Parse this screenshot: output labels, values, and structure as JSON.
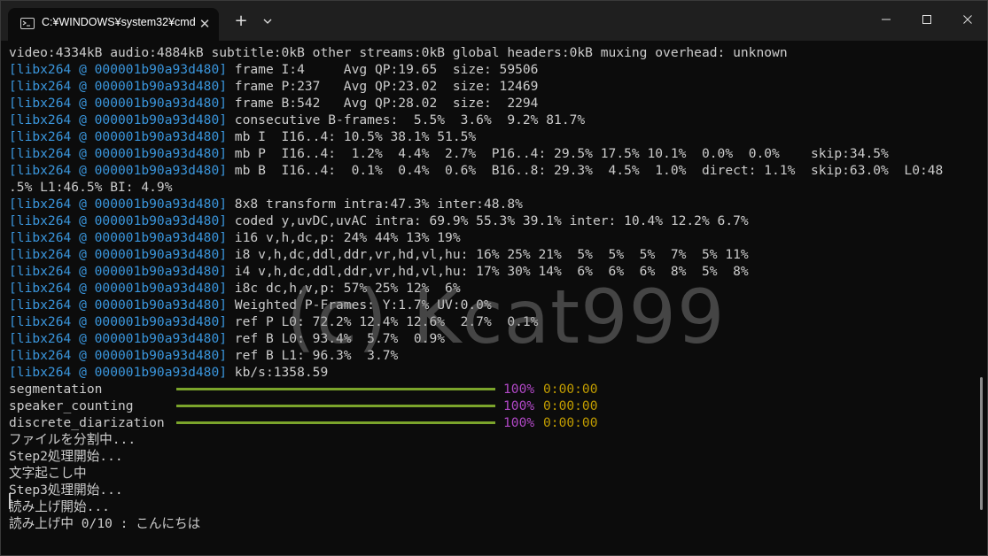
{
  "window": {
    "tab_title": "C:¥WINDOWS¥system32¥cmd",
    "controls": {
      "minimize": "minimize-icon",
      "maximize": "maximize-icon",
      "close": "close-icon"
    }
  },
  "terminal": {
    "tag": "[libx264 @ 000001b90a93d480]",
    "header_line": "video:4334kB audio:4884kB subtitle:0kB other streams:0kB global headers:0kB muxing overhead: unknown",
    "log_lines": [
      " frame I:4     Avg QP:19.65  size: 59506",
      " frame P:237   Avg QP:23.02  size: 12469",
      " frame B:542   Avg QP:28.02  size:  2294",
      " consecutive B-frames:  5.5%  3.6%  9.2% 81.7%",
      " mb I  I16..4: 10.5% 38.1% 51.5%",
      " mb P  I16..4:  1.2%  4.4%  2.7%  P16..4: 29.5% 17.5% 10.1%  0.0%  0.0%    skip:34.5%",
      " mb B  I16..4:  0.1%  0.4%  0.6%  B16..8: 29.3%  4.5%  1.0%  direct: 1.1%  skip:63.0%  L0:48"
    ],
    "wrap_line": ".5% L1:46.5% BI: 4.9%",
    "log_lines_2": [
      " 8x8 transform intra:47.3% inter:48.8%",
      " coded y,uvDC,uvAC intra: 69.9% 55.3% 39.1% inter: 10.4% 12.2% 6.7%",
      " i16 v,h,dc,p: 24% 44% 13% 19%",
      " i8 v,h,dc,ddl,ddr,vr,hd,vl,hu: 16% 25% 21%  5%  5%  5%  7%  5% 11%",
      " i4 v,h,dc,ddl,ddr,vr,hd,vl,hu: 17% 30% 14%  6%  6%  6%  8%  5%  8%",
      " i8c dc,h,v,p: 57% 25% 12%  6%",
      " Weighted P-Frames: Y:1.7% UV:0.0%",
      " ref P L0: 72.2% 12.4% 12.6%  2.7%  0.1%",
      " ref B L0: 93.4%  5.7%  0.9%",
      " ref B L1: 96.3%  3.7%",
      " kb/s:1358.59"
    ],
    "progress": [
      {
        "label": "segmentation",
        "percent": "100%",
        "fraction": 1.0,
        "time": "0:00:00"
      },
      {
        "label": "speaker_counting",
        "percent": "100%",
        "fraction": 1.0,
        "time": "0:00:00"
      },
      {
        "label": "discrete_diarization",
        "percent": "100%",
        "fraction": 1.0,
        "time": "0:00:00"
      }
    ],
    "messages": [
      "ファイルを分割中...",
      "Step2処理開始...",
      "文字起こし中",
      "Step3処理開始...",
      "読み上げ開始...",
      "読み上げ中 0/10 : こんにちは"
    ],
    "watermark": "(c) Kcat999"
  },
  "colors": {
    "tag": "#3a96dd",
    "text": "#cccccc",
    "bar_fill": "#7ba42b",
    "percent": "#b148c6",
    "time": "#c19c00"
  }
}
